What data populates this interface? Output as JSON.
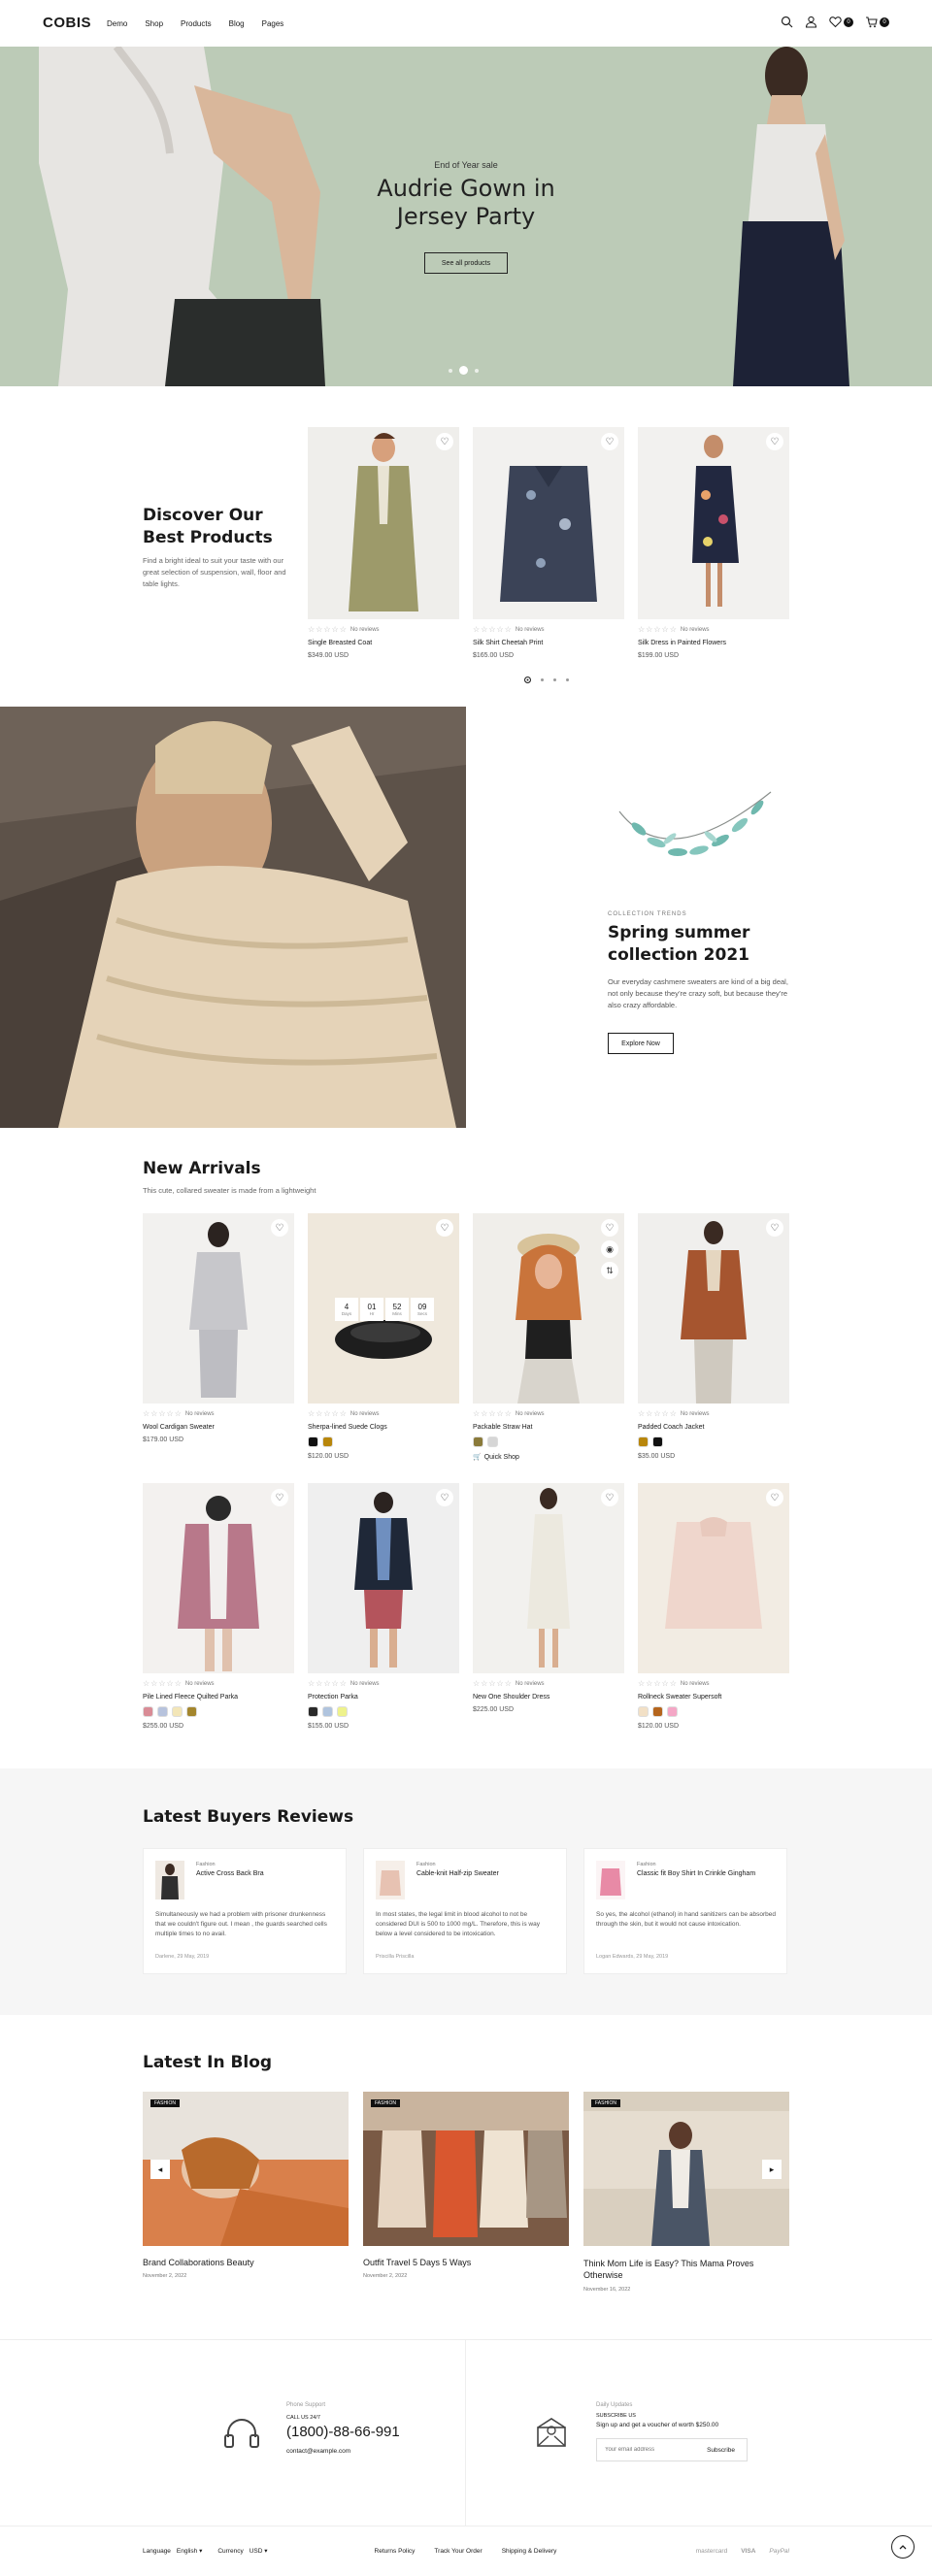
{
  "brand": "COBIS",
  "nav": [
    "Demo",
    "Shop",
    "Products",
    "Blog",
    "Pages"
  ],
  "header_counts": {
    "wishlist": "0",
    "cart": "0"
  },
  "hero": {
    "eyebrow": "End of Year sale",
    "title_line1": "Audrie Gown in",
    "title_line2": "Jersey Party",
    "button": "See all products",
    "colors": {
      "bg": "#bccbb7"
    }
  },
  "best": {
    "title_line1": "Discover Our",
    "title_line2": "Best Products",
    "description": "Find a bright ideal to suit your taste with our great selection of suspension, wall, floor and table lights.",
    "products": [
      {
        "name": "Single Breasted Coat",
        "reviews": "No reviews",
        "price": "$349.00 USD"
      },
      {
        "name": "Silk Shirt Cheetah Print",
        "reviews": "No reviews",
        "price": "$165.00 USD"
      },
      {
        "name": "Silk Dress in Painted Flowers",
        "reviews": "No reviews",
        "price": "$199.00 USD"
      }
    ]
  },
  "collection": {
    "eyebrow": "COLLECTION TRENDS",
    "title_line1": "Spring summer",
    "title_line2": "collection 2021",
    "text": "Our everyday cashmere sweaters are kind of a big deal, not only because they’re crazy soft, but because they’re also crazy affordable.",
    "button": "Explore Now"
  },
  "arrivals": {
    "title": "New Arrivals",
    "subtitle": "This cute, collared sweater is made from a lightweight",
    "countdown": [
      {
        "value": "4",
        "label": "Days"
      },
      {
        "value": "01",
        "label": "Hr"
      },
      {
        "value": "52",
        "label": "Mins"
      },
      {
        "value": "09",
        "label": "Secs"
      }
    ],
    "quick_shop": "Quick Shop",
    "products": [
      {
        "name": "Wool Cardigan Sweater",
        "reviews": "No reviews",
        "price": "$179.00 USD",
        "swatches": []
      },
      {
        "name": "Sherpa-lined Suede Clogs",
        "reviews": "No reviews",
        "price": "$120.00 USD",
        "swatches": [
          "#111111",
          "#b8860b"
        ]
      },
      {
        "name": "Packable Straw Hat",
        "reviews": "No reviews",
        "price": "",
        "swatches": [
          "#8a7a3a",
          "#d6d6d6"
        ]
      },
      {
        "name": "Padded Coach Jacket",
        "reviews": "No reviews",
        "price": "$35.00 USD",
        "swatches": [
          "#b8860b",
          "#111111"
        ]
      },
      {
        "name": "Pile Lined Fleece Quilted Parka",
        "reviews": "No reviews",
        "price": "$255.00 USD",
        "swatches": [
          "#d98c96",
          "#b7c3dd",
          "#f3e6b8",
          "#a4862d"
        ]
      },
      {
        "name": "Protection Parka",
        "reviews": "No reviews",
        "price": "$155.00 USD",
        "swatches": [
          "#2a2a2a",
          "#b0c4de",
          "#eef28c"
        ]
      },
      {
        "name": "New One Shoulder Dress",
        "reviews": "No reviews",
        "price": "$225.00 USD",
        "swatches": []
      },
      {
        "name": "Rollneck Sweater Supersoft",
        "reviews": "No reviews",
        "price": "$120.00 USD",
        "swatches": [
          "#f2e0c6",
          "#b5651d",
          "#f4a7c6"
        ]
      }
    ]
  },
  "reviews": {
    "title": "Latest Buyers Reviews",
    "items": [
      {
        "category": "Fashion",
        "product": "Active Cross Back Bra",
        "text": "Simultaneously we had a problem with prisoner drunkenness that we couldn't figure out. I mean , the guards searched cells multiple times to no avail.",
        "author": "Darlene, 29 May, 2019"
      },
      {
        "category": "Fashion",
        "product": "Cable-knit Half-zip Sweater",
        "text": "In most states, the legal limit in blood alcohol to not be considered DUI is 500 to 1000 mg/L. Therefore, this is way below a level considered to be intoxication.",
        "author": "Priscilla Priscilla"
      },
      {
        "category": "Fashion",
        "product": "Classic fit Boy Shirt In Crinkle Gingham",
        "text": "So yes, the alcohol (ethanol) in hand sanitizers can be absorbed through the skin, but it would not cause intoxication.",
        "author": "Logan Edwards, 29 May, 2019"
      }
    ]
  },
  "blog": {
    "title": "Latest In Blog",
    "posts": [
      {
        "tag": "FASHION",
        "title": "Brand Collaborations Beauty",
        "date": "November 2, 2022"
      },
      {
        "tag": "FASHION",
        "title": "Outfit Travel 5 Days 5 Ways",
        "date": "November 2, 2022"
      },
      {
        "tag": "FASHION",
        "title": "Think Mom Life is Easy? This Mama Proves Otherwise",
        "date": "November 16, 2022"
      }
    ]
  },
  "contact": {
    "label": "Phone Support",
    "call": "CALL US 24/7",
    "phone": "(1800)-88-66-991",
    "email": "contact@example.com"
  },
  "newsletter": {
    "label": "Daily Updates",
    "subscribe_title": "SUBSCRIBE US",
    "text": "Sign up and get a voucher of worth $250.00",
    "placeholder": "Your email address",
    "button": "Subscribe"
  },
  "footer": {
    "language_label": "Language",
    "language_value": "English",
    "currency_label": "Currency",
    "currency_value": "USD",
    "links": [
      "Returns Policy",
      "Track Your Order",
      "Shipping & Delivery"
    ],
    "payments": [
      "mastercard",
      "VISA",
      "PayPal"
    ]
  }
}
